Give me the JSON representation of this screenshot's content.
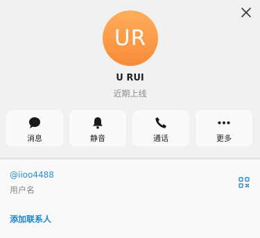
{
  "profile": {
    "initials": "UR",
    "name": "U RUI",
    "status": "近期上线",
    "avatar_color_top": "#ffae5a",
    "avatar_color_bottom": "#f78b3a"
  },
  "actions": [
    {
      "label": "消息",
      "icon": "chat-bubble-icon"
    },
    {
      "label": "静音",
      "icon": "bell-icon"
    },
    {
      "label": "通话",
      "icon": "phone-icon"
    },
    {
      "label": "更多",
      "icon": "more-dots-icon"
    }
  ],
  "info": {
    "username": "@iioo4488",
    "username_caption": "用户名",
    "add_contact": "添加联系人"
  },
  "colors": {
    "link": "#2a8fd0",
    "accent": "#1f86cf"
  }
}
